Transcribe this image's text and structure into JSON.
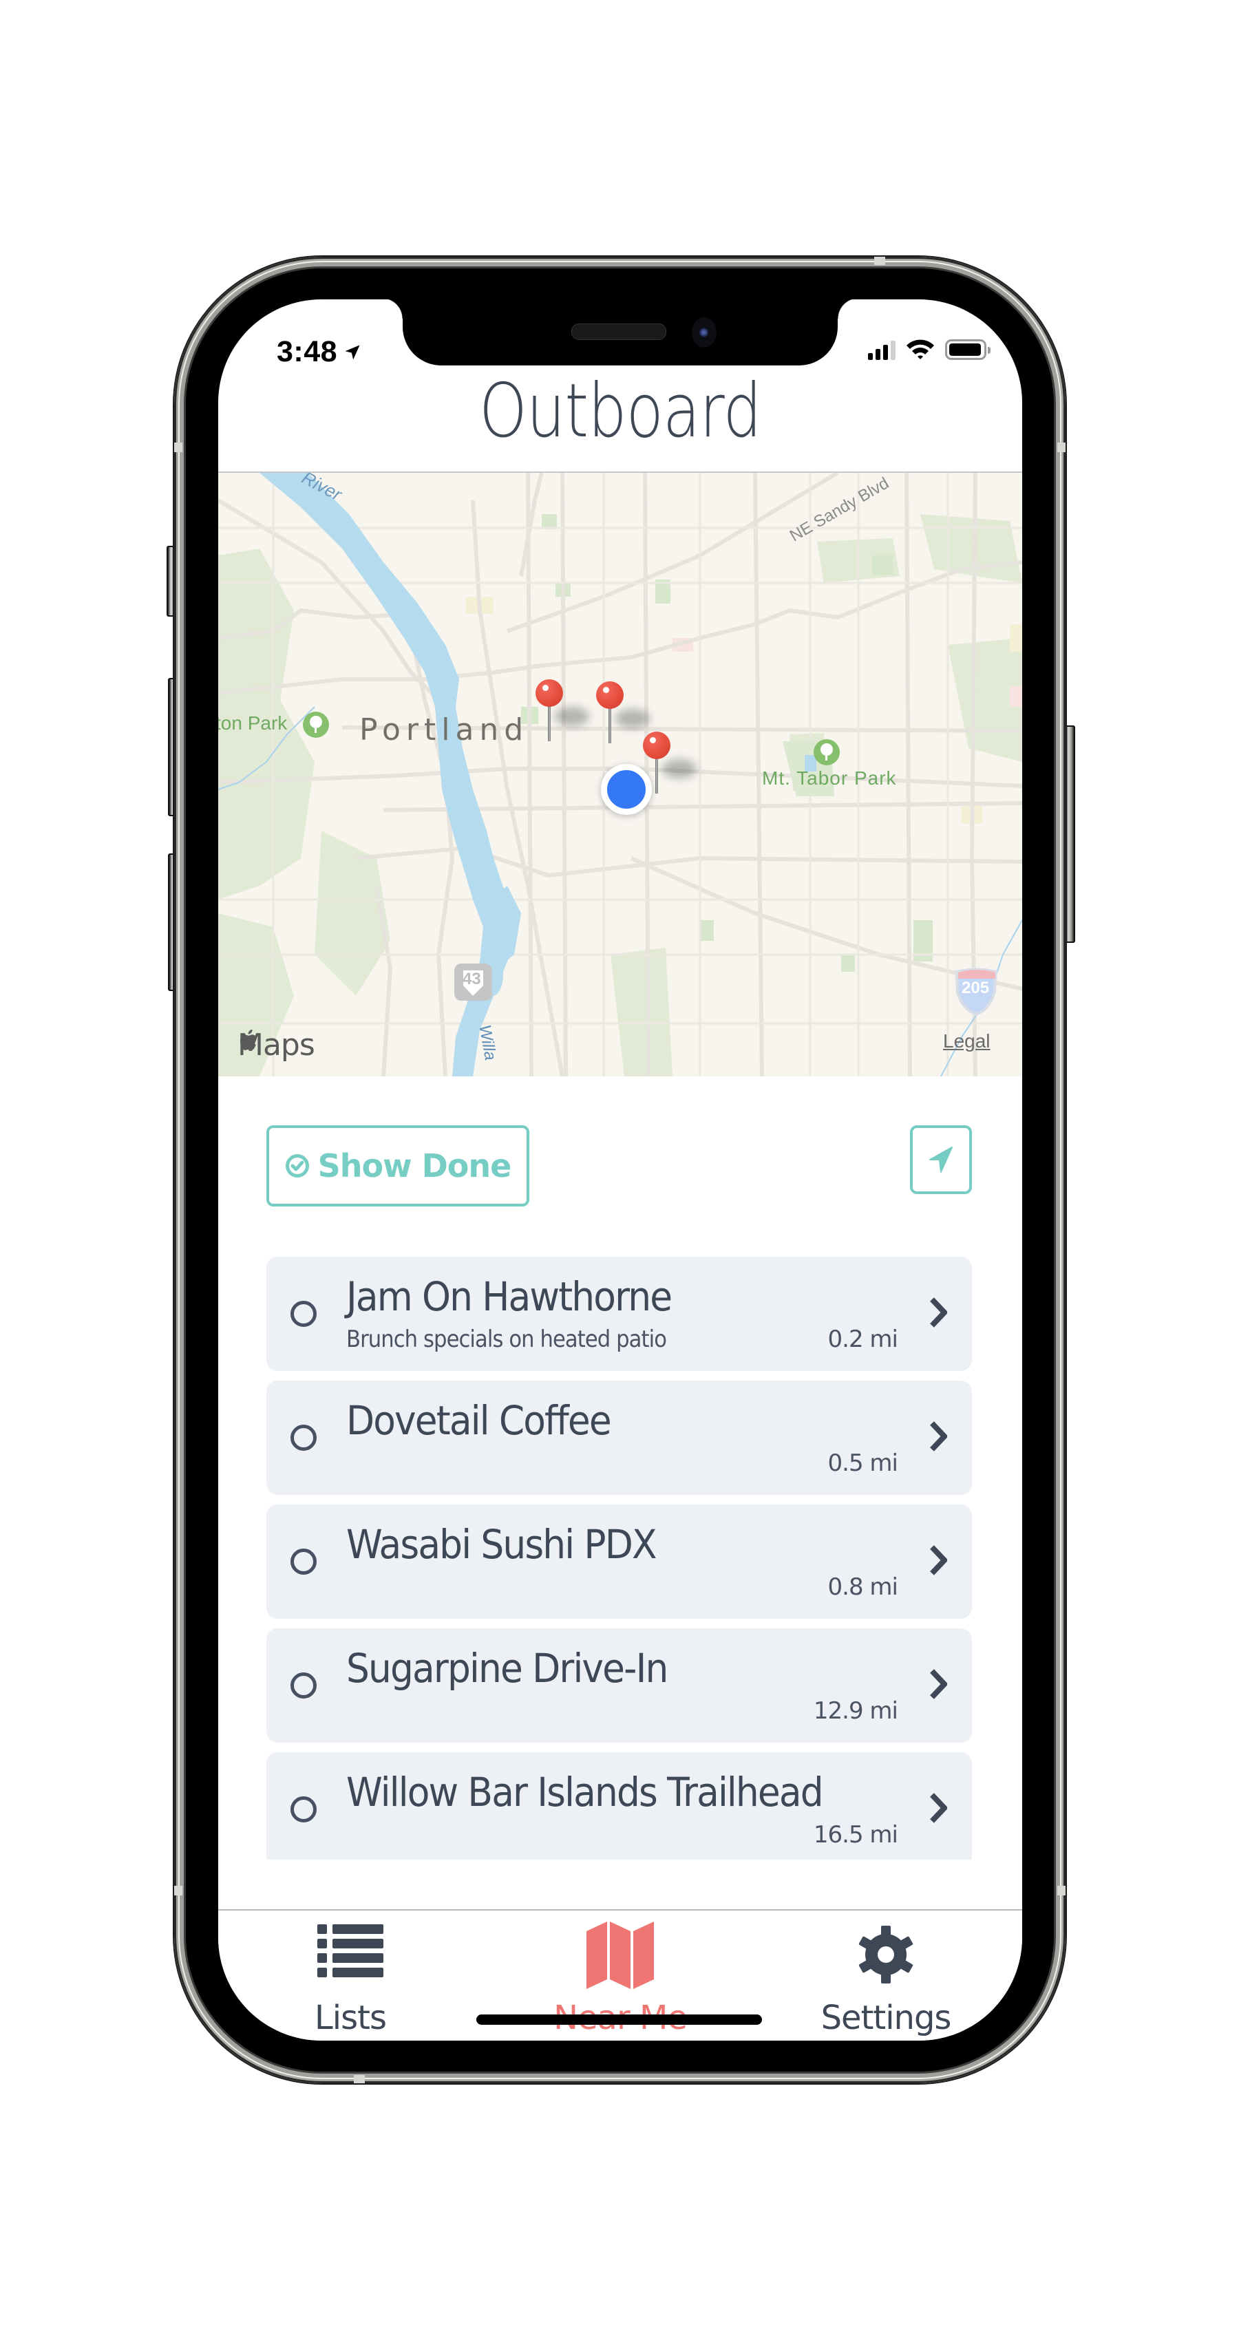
{
  "status_bar": {
    "time": "3:48",
    "location_icon": "location-arrow-icon",
    "signal_bars_filled": 3,
    "signal_bars_total": 4,
    "wifi_icon": "wifi-icon",
    "battery_level": 0.95
  },
  "header": {
    "title": "Outboard"
  },
  "map": {
    "labels": {
      "river_top": "River",
      "city": "Portland",
      "park_left": "ton Park",
      "park_right": "Mt. Tabor Park",
      "street": "NE Sandy Blvd",
      "river_bottom": "Willa",
      "route_43": "43",
      "route_205": "205",
      "attribution": "Maps",
      "legal": "Legal"
    },
    "pin_count": 3,
    "user_location": "blue-dot"
  },
  "controls": {
    "show_done_label": "Show Done",
    "show_done_icon": "check-circle-icon",
    "locate_icon": "location-arrow-icon"
  },
  "places": [
    {
      "name": "Jam On Hawthorne",
      "note": "Brunch specials on heated patio",
      "distance": "0.2 mi",
      "done": false
    },
    {
      "name": "Dovetail Coffee",
      "note": "",
      "distance": "0.5 mi",
      "done": false
    },
    {
      "name": "Wasabi Sushi PDX",
      "note": "",
      "distance": "0.8 mi",
      "done": false
    },
    {
      "name": "Sugarpine Drive-In",
      "note": "",
      "distance": "12.9 mi",
      "done": false
    },
    {
      "name": "Willow Bar Islands Trailhead",
      "note": "",
      "distance": "16.5 mi",
      "done": false
    }
  ],
  "tabs": [
    {
      "label": "Lists",
      "icon": "list-icon",
      "active": false
    },
    {
      "label": "Near Me",
      "icon": "map-icon",
      "active": true
    },
    {
      "label": "Settings",
      "icon": "gear-icon",
      "active": false
    }
  ],
  "colors": {
    "accent": "#76cdc4",
    "active_tab": "#ee7571",
    "text": "#3e4756",
    "row_bg": "#edf0f5",
    "pin": "#e54b3a",
    "user_dot": "#3478f6"
  }
}
